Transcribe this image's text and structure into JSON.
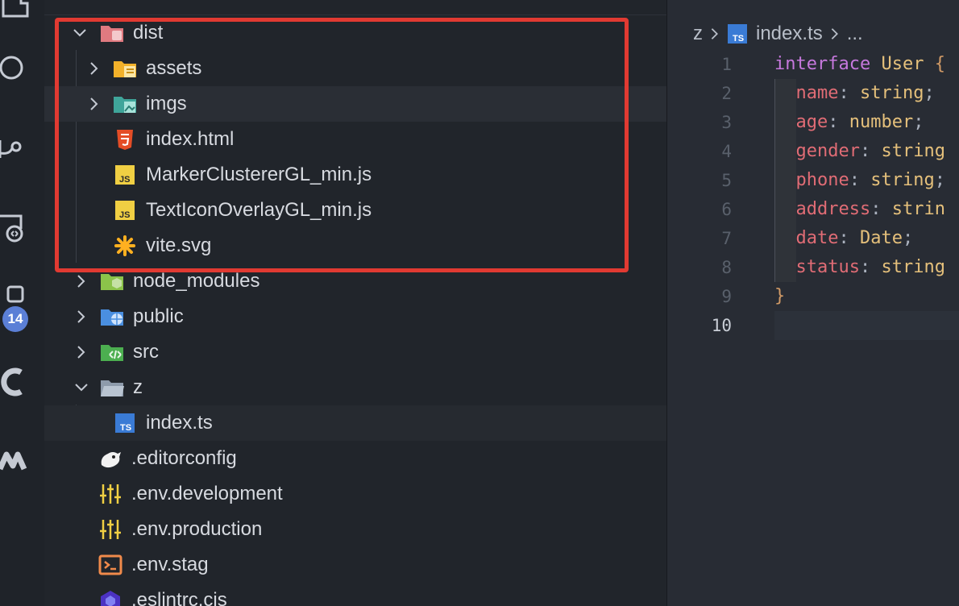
{
  "activity_bar": {
    "icons": [
      "explorer-icon",
      "search-icon",
      "source-control-icon",
      "remote-explorer-icon",
      "extensions-icon",
      "gitlens-icon",
      "codeium-icon"
    ],
    "extensions_badge": "14"
  },
  "explorer": {
    "dist": "dist",
    "assets": "assets",
    "imgs": "imgs",
    "index_html": "index.html",
    "marker_js": "MarkerClustererGL_min.js",
    "texticon_js": "TextIconOverlayGL_min.js",
    "vite_svg": "vite.svg",
    "node_modules": "node_modules",
    "public": "public",
    "src": "src",
    "z": "z",
    "index_ts": "index.ts",
    "editorconfig": ".editorconfig",
    "env_development": ".env.development",
    "env_production": ".env.production",
    "env_stag": ".env.stag",
    "eslintrc": ".eslintrc.cjs"
  },
  "editor": {
    "breadcrumb": {
      "folder": "z",
      "file": "index.ts",
      "more": "..."
    },
    "line_numbers": [
      "1",
      "2",
      "3",
      "4",
      "5",
      "6",
      "7",
      "8",
      "9",
      "10"
    ],
    "active_line": "10",
    "code": {
      "l1_kw": "interface",
      "l1_name": "User",
      "l1_brace": "{",
      "l2_prop": "name",
      "l2_type": "string",
      "l2_end": ";",
      "l3_prop": "age",
      "l3_type": "number",
      "l3_end": ";",
      "l4_prop": "gender",
      "l4_type": "string",
      "l4_end": "",
      "l5_prop": "phone",
      "l5_type": "string",
      "l5_end": ";",
      "l6_prop": "address",
      "l6_type": "strin",
      "l6_end": "",
      "l7_prop": "date",
      "l7_type": "Date",
      "l7_end": ";",
      "l8_prop": "status",
      "l8_type": "string",
      "l8_end": "",
      "l9_brace": "}",
      "colon": ":"
    }
  },
  "colors": {
    "highlight_border": "#e13a32",
    "keyword": "#c678dd",
    "type": "#e5c07b",
    "property": "#e06c75",
    "badge": "#5b7fd6"
  }
}
